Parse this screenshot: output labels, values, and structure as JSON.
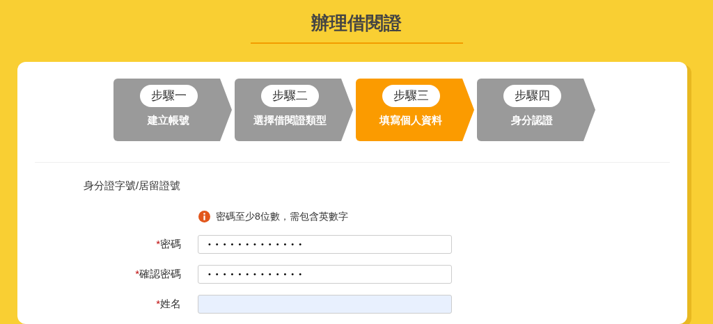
{
  "page_title": "辦理借閱證",
  "steps": [
    {
      "label": "步驟一",
      "title": "建立帳號",
      "selected": false
    },
    {
      "label": "步驟二",
      "title": "選擇借閱證類型",
      "selected": false
    },
    {
      "label": "步驟三",
      "title": "填寫個人資料",
      "selected": true
    },
    {
      "label": "步驟四",
      "title": "身分認證",
      "selected": false
    }
  ],
  "section_label": "身分證字號/居留證號",
  "hint": "密碼至少8位數，需包含英數字",
  "fields": [
    {
      "required_mark": "*",
      "label": "密碼",
      "value": "•••••••••••••",
      "highlighted": false
    },
    {
      "required_mark": "*",
      "label": "確認密碼",
      "value": "•••••••••••••",
      "highlighted": false
    },
    {
      "required_mark": "*",
      "label": "姓名",
      "highlighted": true
    }
  ]
}
